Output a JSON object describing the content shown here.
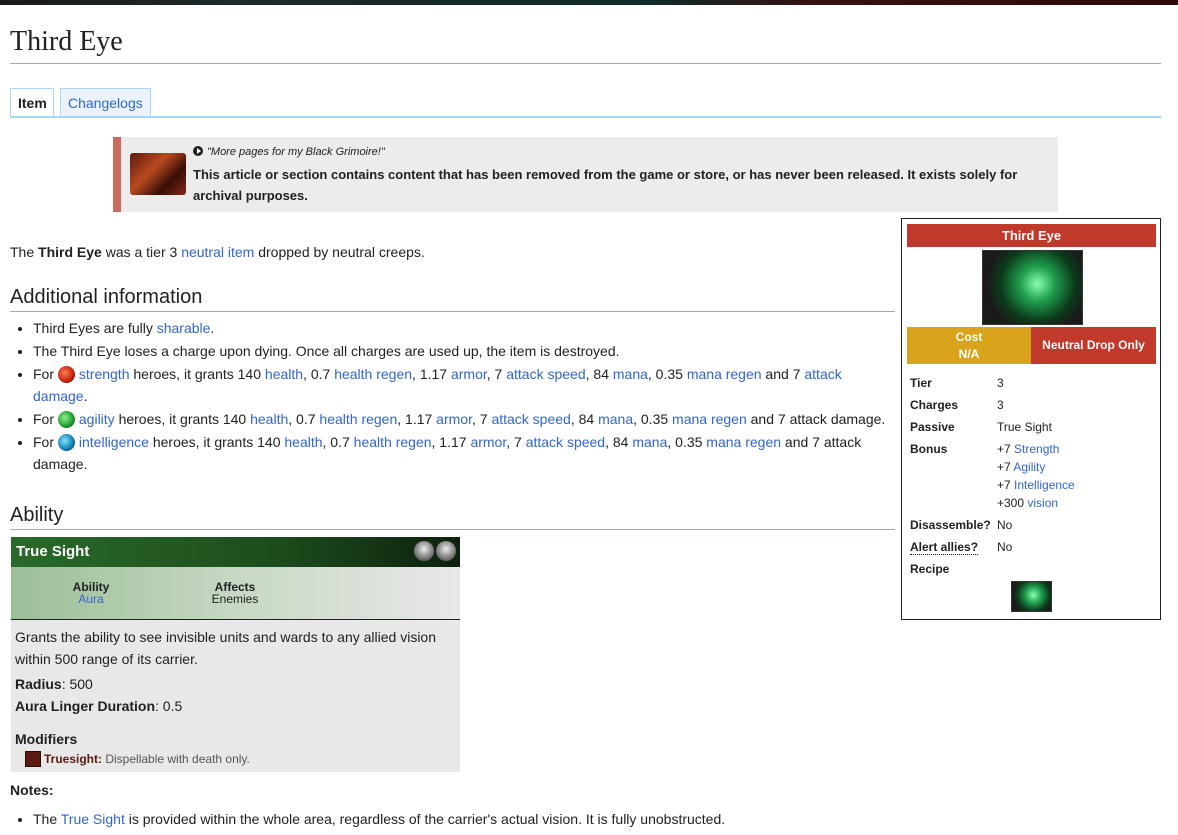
{
  "page": {
    "title": "Third Eye"
  },
  "tabs": [
    {
      "label": "Item"
    },
    {
      "label": "Changelogs"
    }
  ],
  "notice": {
    "quote": "\"More pages for my Black Grimoire!\"",
    "text": "This article or section contains content that has been removed from the game or store, or has never been released. It exists solely for archival purposes."
  },
  "intro": {
    "pre": "The ",
    "bold": "Third Eye",
    "mid": " was a tier 3 ",
    "link": "neutral item",
    "post": " dropped by neutral creeps."
  },
  "sections": {
    "additional": "Additional information",
    "ability": "Ability"
  },
  "info": {
    "sharable_pre": "Third Eyes are fully ",
    "sharable_link": "sharable",
    "sharable_post": ".",
    "charge": "The Third Eye loses a charge upon dying. Once all charges are used up, the item is destroyed.",
    "for": "For",
    "heroes_grants": " heroes, it grants 140 ",
    "health": "health",
    "sep1": ", 0.7 ",
    "health_regen": "health regen",
    "sep2": ", 1.17 ",
    "armor": "armor",
    "sep3": ", 7 ",
    "attack_speed": "attack speed",
    "sep4": ", 84 ",
    "mana": "mana",
    "sep5": ", 0.35 ",
    "mana_regen": "mana regen",
    "and7": " and 7 ",
    "attack_damage": "attack damage",
    "attack_damage_plain": "attack damage",
    "period": ".",
    "strength": "strength",
    "agility": "agility",
    "intelligence": "intelligence"
  },
  "ability": {
    "name": "True Sight",
    "meta_ability_label": "Ability",
    "meta_ability_value": "Aura",
    "meta_affects_label": "Affects",
    "meta_affects_value": "Enemies",
    "desc": "Grants the ability to see invisible units and wards to any allied vision within 500 range of its carrier.",
    "radius_label": "Radius",
    "radius_value": ": 500",
    "linger_label": "Aura Linger Duration",
    "linger_value": ": 0.5",
    "modifiers_title": "Modifiers",
    "modifier_name": "Truesight:",
    "modifier_desc": " Dispellable with death only."
  },
  "notes": {
    "title": "Notes:",
    "pre": "The ",
    "link": "True Sight",
    "post": " is provided within the whole area, regardless of the carrier's actual vision. It is fully unobstructed."
  },
  "infobox": {
    "title": "Third Eye",
    "cost_label": "Cost",
    "cost_value": "N/A",
    "drop": "Neutral Drop Only",
    "tier_label": "Tier",
    "tier_value": "3",
    "charges_label": "Charges",
    "charges_value": "3",
    "passive_label": "Passive",
    "passive_value": "True Sight",
    "bonus_label": "Bonus",
    "bonus_1_num": "+7 ",
    "bonus_1_name": "Strength",
    "bonus_2_num": "+7 ",
    "bonus_2_name": "Agility",
    "bonus_3_num": "+7 ",
    "bonus_3_name": "Intelligence",
    "bonus_4_num": "+300 ",
    "bonus_4_name": "vision",
    "disassemble_label": "Disassemble?",
    "disassemble_value": "No",
    "alert_label": "Alert allies?",
    "alert_value": "No",
    "recipe_label": "Recipe"
  },
  "colors": {
    "link": "#3366cc",
    "header_red": "#c0392b",
    "cost_gold": "#d9a41c",
    "ability_green": "#2a6a2a"
  }
}
